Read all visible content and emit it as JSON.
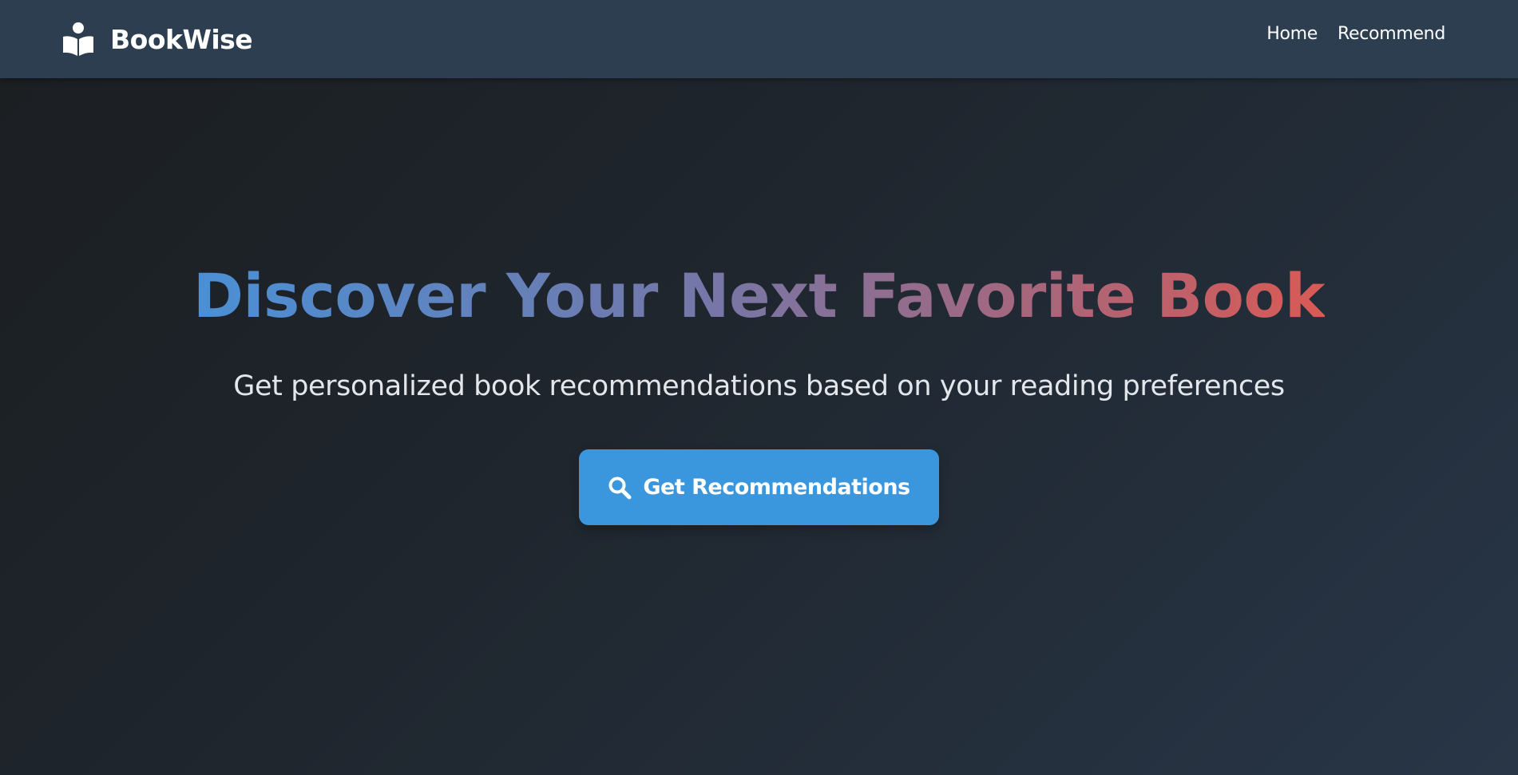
{
  "navbar": {
    "brand": {
      "name": "BookWise",
      "icon": "reader-book-icon"
    },
    "links": [
      {
        "label": "Home"
      },
      {
        "label": "Recommend"
      }
    ]
  },
  "hero": {
    "title": "Discover Your Next Favorite Book",
    "subtitle": "Get personalized book recommendations based on your reading preferences",
    "cta": {
      "label": "Get Recommendations",
      "icon": "search-icon"
    }
  },
  "colors": {
    "navbar_bg": "#2d3e50",
    "page_bg_start": "#1b1e21",
    "page_bg_end": "#283647",
    "title_gradient_start": "#4a90d6",
    "title_gradient_end": "#d95a55",
    "cta_bg": "#3a97dd",
    "text_primary": "#ffffff",
    "text_secondary": "#e3e6ea"
  }
}
